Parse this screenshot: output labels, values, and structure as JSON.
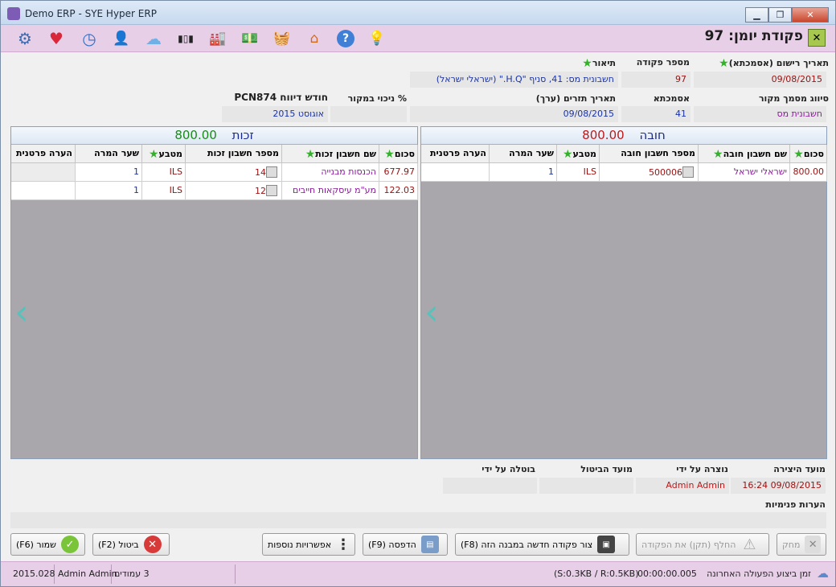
{
  "window": {
    "title": "Demo ERP - SYE Hyper ERP",
    "min": "▁",
    "max": "❐",
    "close": "✕"
  },
  "toolbar": {
    "icons": [
      "lightbulb-icon",
      "help-icon",
      "home-icon",
      "basket-icon",
      "cash-icon",
      "factory-icon",
      "barcode-icon",
      "cloud-icon",
      "user-icon",
      "clock-icon",
      "heart-icon",
      "gear-icon"
    ],
    "glyphs": {
      "lightbulb": "💡",
      "help": "?",
      "home": "⌂",
      "basket": "🧺",
      "cash": "💵",
      "factory": "🏭",
      "barcode": "▮▯▮",
      "cloud": "☁",
      "user": "👤",
      "clock": "◷",
      "heart": "♥",
      "gear": "⚙"
    }
  },
  "page": {
    "title": "פקודת יומן: 97",
    "close_glyph": "✕"
  },
  "header": {
    "reg_date_label": "תאריך רישום (אסמכתא)",
    "reg_date": "09/08/2015",
    "entry_no_label": "מספר פקודה",
    "entry_no": "97",
    "desc_label": "תיאור",
    "desc": "חשבונית מס: 41, סניף \"H.Q.\" (ישראלי ישראל)",
    "doc_type_label": "סיווג מסמך מקור",
    "doc_type": "חשבונית מס",
    "ref_label": "אסמכתא",
    "ref": "41",
    "value_date_label": "תאריך תזרים (ערך)",
    "value_date": "09/08/2015",
    "withholding_label": "% ניכוי במקור",
    "withholding": "",
    "report_month_label": "חודש דיווח PCN874",
    "report_month": "אוגוסט 2015"
  },
  "debit": {
    "title": "חובה",
    "total": "800.00",
    "columns": [
      "סכום",
      "שם חשבון חובה",
      "מספר חשבון חובה",
      "מטבע",
      "שער המרה",
      "הערה פרטנית"
    ],
    "rows": [
      [
        "800.00",
        "ישראלי ישראל",
        "500006",
        "ILS",
        "1",
        ""
      ]
    ]
  },
  "credit": {
    "title": "זכות",
    "total": "800.00",
    "columns": [
      "סכום",
      "שם חשבון זכות",
      "מספר חשבון זכות",
      "מטבע",
      "שער המרה",
      "הערה פרטנית"
    ],
    "rows": [
      [
        "677.97",
        "הכנסות מבנייה",
        "14",
        "ILS",
        "1",
        ""
      ],
      [
        "122.03",
        "מע\"מ עיסקאות חייבים",
        "12",
        "ILS",
        "1",
        ""
      ]
    ]
  },
  "arrow_glyph": "‹",
  "audit": {
    "created_time_label": "מועד היצירה",
    "created_time": "09/08/2015 16:24",
    "created_by_label": "נוצרה על ידי",
    "created_by": "Admin Admin",
    "cancel_time_label": "מועד הביטול",
    "cancel_time": "",
    "cancel_by_label": "בוטלה על ידי",
    "cancel_by": "",
    "notes_label": "הערות פנימיות"
  },
  "buttons": {
    "delete": "מחק",
    "replace": "החלף (תקן) את הפקודה",
    "create_similar": "צור פקודה חדשה במבנה הזה (F8)",
    "print": "הדפסה (F9)",
    "more": "אפשרויות נוספות",
    "cancel": "ביטול (F2)",
    "save": "שמור (F6)",
    "ok_glyph": "✓",
    "x_glyph": "✕",
    "warn_glyph": "⚠",
    "dots_glyph": "⋮"
  },
  "status": {
    "last_op_label": "זמן ביצוע הפעולה האחרונה",
    "last_op_time": "00:00:00.005",
    "size": "(S:0.3KB / R:0.5KB)",
    "pages": "3 עמודים",
    "user": "Admin Admin",
    "version": "2015.028"
  }
}
